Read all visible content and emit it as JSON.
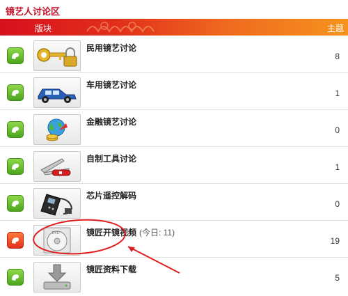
{
  "title": "镜艺人讨论区",
  "header": {
    "board_label": "版块",
    "topics_label": "主题"
  },
  "forums": [
    {
      "name": "民用镜艺讨论",
      "thumb_icon": "key-lock-icon",
      "topics": "8",
      "is_new": false,
      "today": ""
    },
    {
      "name": "车用镜艺讨论",
      "thumb_icon": "car-icon",
      "topics": "1",
      "is_new": false,
      "today": ""
    },
    {
      "name": "金融镜艺讨论",
      "thumb_icon": "globe-coins-icon",
      "topics": "0",
      "is_new": false,
      "today": ""
    },
    {
      "name": "自制工具讨论",
      "thumb_icon": "multitool-knife-icon",
      "topics": "1",
      "is_new": false,
      "today": ""
    },
    {
      "name": "芯片遥控解码",
      "thumb_icon": "remote-programmer-icon",
      "topics": "0",
      "is_new": false,
      "today": ""
    },
    {
      "name": "镜匠开镜视频",
      "thumb_icon": "dvd-disc-icon",
      "topics": "19",
      "is_new": true,
      "today": "(今日: 11)"
    },
    {
      "name": "镜匠资料下载",
      "thumb_icon": "download-drive-icon",
      "topics": "5",
      "is_new": false,
      "today": ""
    }
  ],
  "colors": {
    "accent_red": "#c0102a",
    "header_start": "#d8101e",
    "header_end": "#f7931e",
    "status_green": "#4ca51c",
    "status_new": "#e0301a",
    "annotation_red": "#e02020"
  }
}
